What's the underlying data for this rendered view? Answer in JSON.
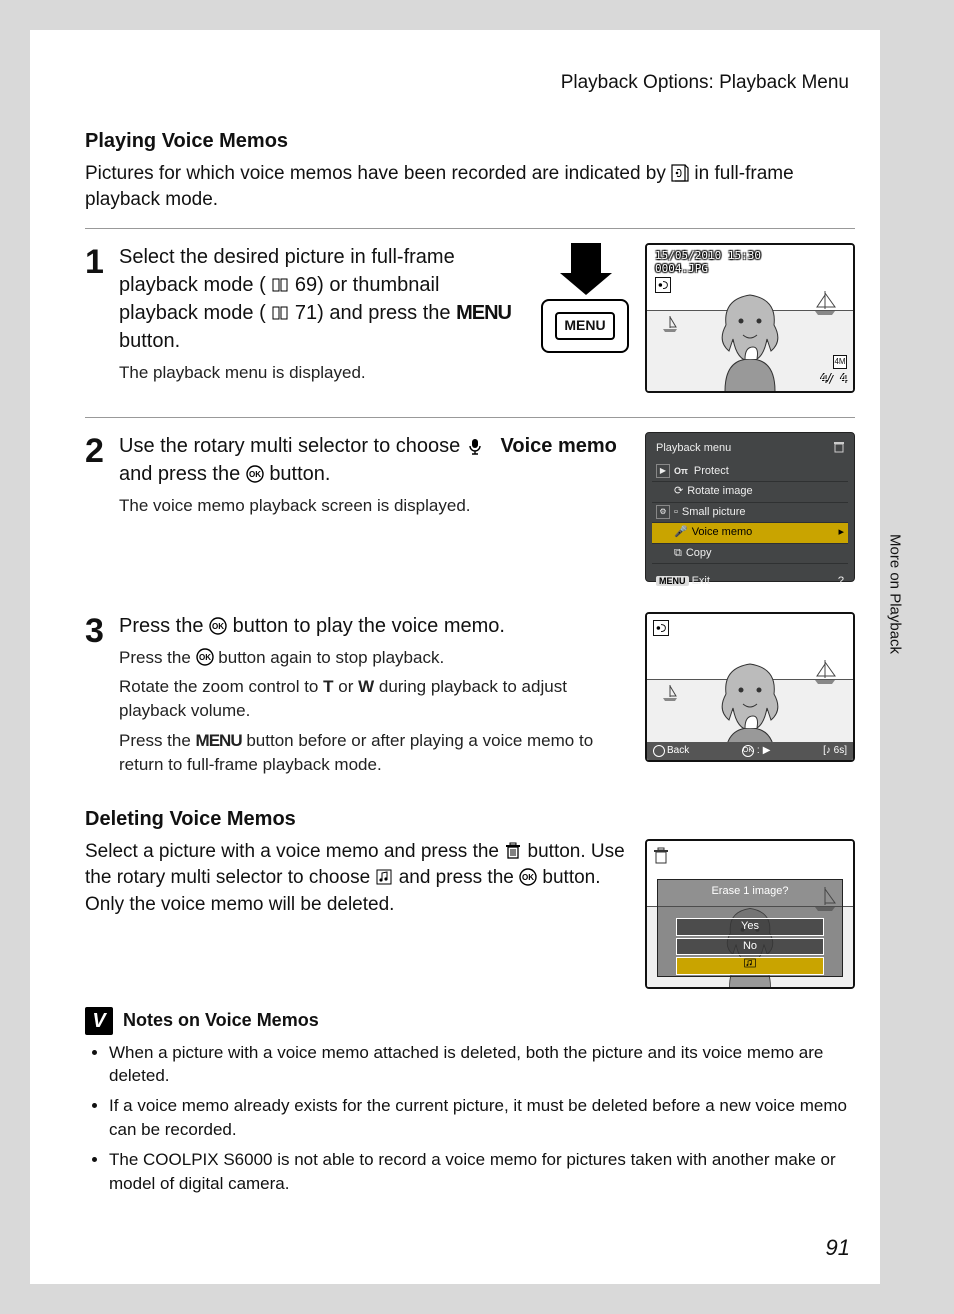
{
  "breadcrumb": "Playback Options: Playback Menu",
  "side_tab": "More on Playback",
  "page_number": "91",
  "section1": {
    "heading": "Playing Voice Memos",
    "intro_a": "Pictures for which voice memos have been recorded are indicated by ",
    "intro_b": " in full-frame playback mode."
  },
  "step1": {
    "num": "1",
    "line_a": "Select the desired picture in full-frame playback mode (",
    "ref1": " 69) or thumbnail playback mode (",
    "ref2": " 71) and press the ",
    "menu_word": "MENU",
    "line_end": " button.",
    "sub": "The playback menu is displayed.",
    "menu_btn_label": "MENU",
    "screen": {
      "datetime": "15/05/2010 15:30",
      "filename": "0004.JPG",
      "counter": "4/   4",
      "size_badge": "4M"
    }
  },
  "step2": {
    "num": "2",
    "line_a": "Use the rotary multi selector to choose ",
    "bold_part": "Voice memo",
    "line_b": " and press the ",
    "ok_word": "OK",
    "line_end": " button.",
    "sub": "The voice memo playback screen is displayed.",
    "menu": {
      "title": "Playback menu",
      "items": [
        "Protect",
        "Rotate image",
        "Small picture",
        "Voice memo",
        "Copy"
      ],
      "selected_index": 3,
      "exit_label": "Exit",
      "exit_btn": "MENU"
    }
  },
  "step3": {
    "num": "3",
    "title_a": "Press the ",
    "title_b": " button to play the voice memo.",
    "sub1_a": "Press the ",
    "sub1_b": " button again to stop playback.",
    "sub2_a": "Rotate the zoom control to ",
    "t": "T",
    "or": " or ",
    "w": "W",
    "sub2_b": " during playback to adjust playback volume.",
    "sub3_a": "Press the ",
    "menu_word": "MENU",
    "sub3_b": " button before or after playing a voice memo to return to full-frame playback mode.",
    "screen": {
      "back": "Back",
      "ok": "OK",
      "time": "6s"
    }
  },
  "section2": {
    "heading": "Deleting Voice Memos",
    "para_a": "Select a picture with a voice memo and press the ",
    "para_b": " button. Use the rotary multi selector to choose ",
    "para_c": " and press the ",
    "para_d": " button. Only the voice memo will be deleted.",
    "screen": {
      "question": "Erase 1 image?",
      "yes": "Yes",
      "no": "No"
    }
  },
  "notes": {
    "title": "Notes on Voice Memos",
    "items": [
      "When a picture with a voice memo attached is deleted, both the picture and its voice memo are deleted.",
      "If a voice memo already exists for the current picture, it must be deleted before a new voice memo can be recorded.",
      "The COOLPIX S6000 is not able to record a voice memo for pictures taken with another make or model of digital camera."
    ]
  }
}
